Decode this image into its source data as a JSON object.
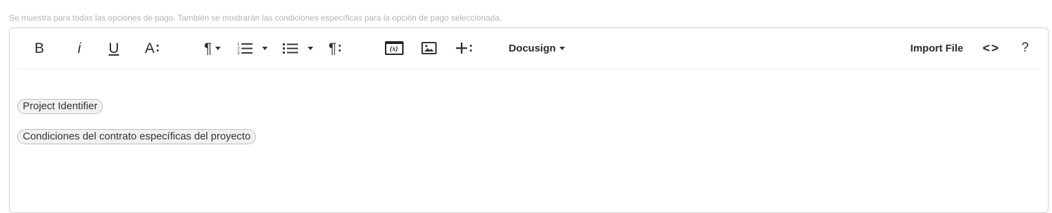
{
  "helper_text": "Se muestra para todas las opciones de pago. También se mostrarán las condiciones específicas para la opción de pago seleccionada.",
  "toolbar": {
    "bold_label": "B",
    "italic_label": "i",
    "underline_label": "U",
    "font_size_label": "A",
    "paragraph_label": "¶",
    "paragraph_format_label": "¶",
    "merge_field_label": "(x)",
    "docusign_label": "Docusign",
    "import_label": "Import File",
    "code_view_label": "<>",
    "help_label": "?"
  },
  "icons": {
    "bold": "bold-icon",
    "italic": "italic-icon",
    "underline": "underline-icon",
    "font_size": "font-size-icon",
    "paragraph": "paragraph-icon",
    "ordered_list": "ordered-list-icon",
    "unordered_list": "unordered-list-icon",
    "paragraph_format": "paragraph-format-icon",
    "variable": "variable-icon",
    "image": "image-icon",
    "insert_more": "plus-icon",
    "code_view": "code-view-icon",
    "help": "help-icon"
  },
  "content": {
    "tokens": [
      "Project Identifier",
      "Condiciones del contrato específicas del proyecto"
    ]
  },
  "colors": {
    "helper_text": "#b3b3b3",
    "border": "#d0d0d0",
    "chip_bg": "#f1f1f1",
    "chip_border": "#bdbdbd",
    "icon": "#2b2b2b"
  }
}
